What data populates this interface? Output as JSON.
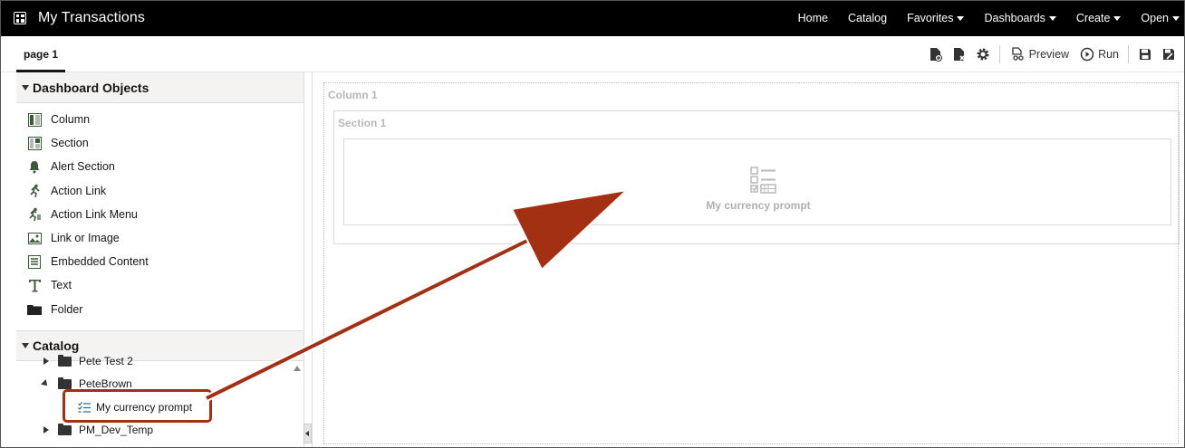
{
  "topbar": {
    "title": "My Transactions",
    "nav": [
      {
        "label": "Home",
        "dropdown": false
      },
      {
        "label": "Catalog",
        "dropdown": false
      },
      {
        "label": "Favorites",
        "dropdown": true
      },
      {
        "label": "Dashboards",
        "dropdown": true
      },
      {
        "label": "Create",
        "dropdown": true
      },
      {
        "label": "Open",
        "dropdown": true
      }
    ]
  },
  "tabs": {
    "active": "page 1"
  },
  "toolbar": {
    "preview_label": "Preview",
    "run_label": "Run"
  },
  "left_panel": {
    "objects_header": "Dashboard Objects",
    "objects": [
      {
        "label": "Column",
        "icon": "column-icon"
      },
      {
        "label": "Section",
        "icon": "section-icon"
      },
      {
        "label": "Alert Section",
        "icon": "bell-icon"
      },
      {
        "label": "Action Link",
        "icon": "runner-icon"
      },
      {
        "label": "Action Link Menu",
        "icon": "runner-menu-icon"
      },
      {
        "label": "Link or Image",
        "icon": "image-link-icon"
      },
      {
        "label": "Embedded Content",
        "icon": "embedded-icon"
      },
      {
        "label": "Text",
        "icon": "text-icon"
      },
      {
        "label": "Folder",
        "icon": "folder-icon"
      }
    ],
    "catalog_header": "Catalog",
    "tree": {
      "row0": "Pete Test 2",
      "row1": "PeteBrown",
      "row2": "My currency prompt",
      "row3": "PM_Dev_Temp"
    }
  },
  "canvas": {
    "column_title": "Column 1",
    "section_title": "Section 1",
    "prompt_label": "My currency prompt"
  },
  "colors": {
    "topbar": "#000000",
    "annotation": "#a43014",
    "placeholder_text": "#b8b8b8"
  }
}
